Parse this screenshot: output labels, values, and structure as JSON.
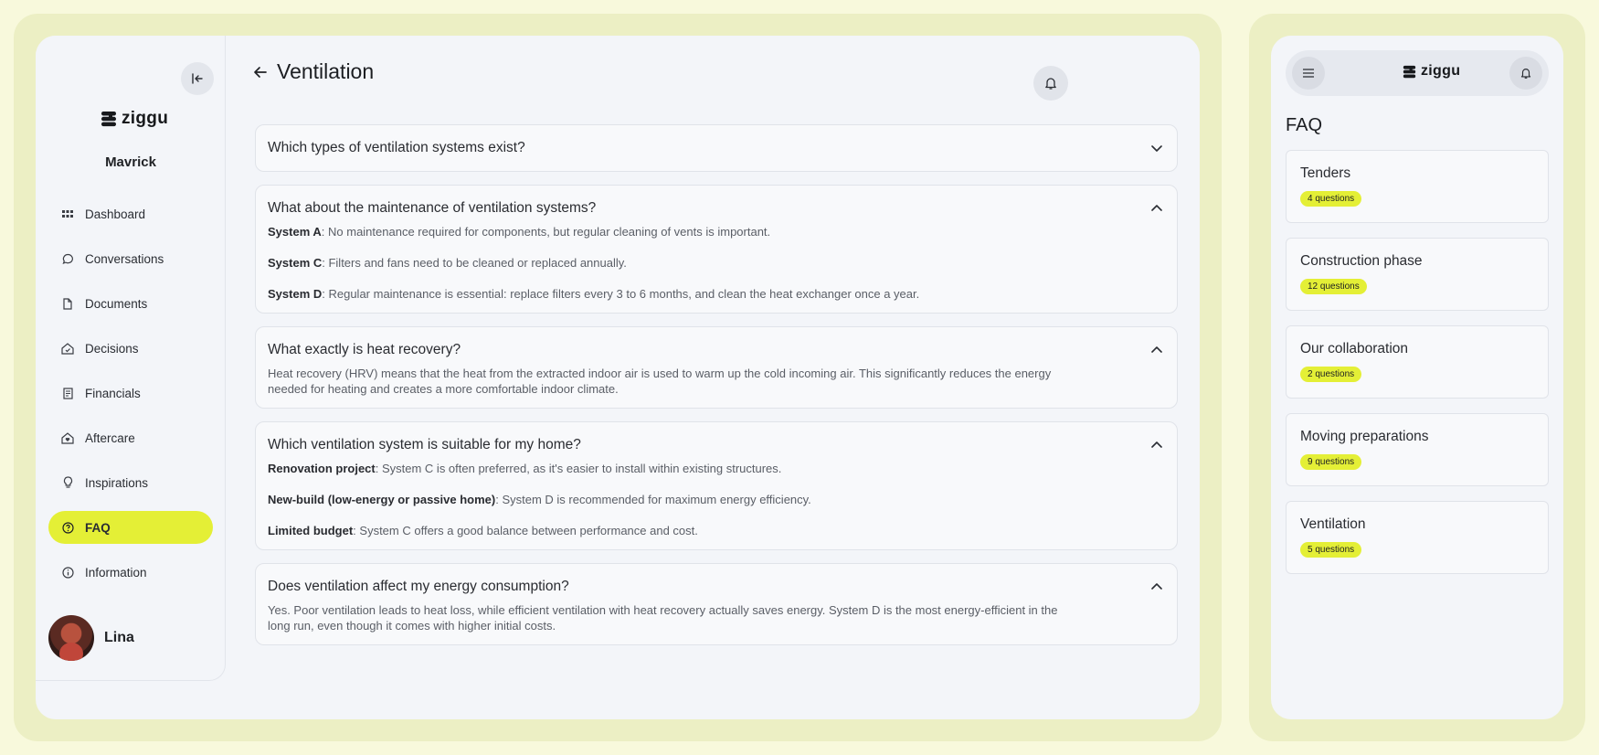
{
  "brand": {
    "name": "ziggu"
  },
  "sidebar": {
    "user_title": "Mavrick",
    "items": [
      {
        "label": "Dashboard",
        "icon": "grid-icon"
      },
      {
        "label": "Conversations",
        "icon": "chat-icon"
      },
      {
        "label": "Documents",
        "icon": "document-icon"
      },
      {
        "label": "Decisions",
        "icon": "house-check-icon"
      },
      {
        "label": "Financials",
        "icon": "receipt-icon"
      },
      {
        "label": "Aftercare",
        "icon": "house-heart-icon"
      },
      {
        "label": "Inspirations",
        "icon": "lightbulb-icon"
      },
      {
        "label": "FAQ",
        "icon": "question-icon",
        "active": true
      },
      {
        "label": "Information",
        "icon": "info-icon"
      }
    ],
    "profile_name": "Lina"
  },
  "main": {
    "title": "Ventilation",
    "faqs": [
      {
        "question": "Which types of ventilation systems exist?",
        "expanded": false
      },
      {
        "question": "What about the maintenance of ventilation systems?",
        "expanded": true,
        "answer_items": [
          {
            "label": "System A",
            "text": ": No maintenance required for components, but regular cleaning of vents is important."
          },
          {
            "label": "System C",
            "text": ": Filters and fans need to be cleaned or replaced annually."
          },
          {
            "label": "System D",
            "text": ": Regular maintenance is essential: replace filters every 3 to 6 months, and clean the heat exchanger once a year."
          }
        ]
      },
      {
        "question": "What exactly is heat recovery?",
        "expanded": true,
        "answer": "Heat recovery (HRV) means that the heat from the extracted indoor air is used to warm up the cold incoming air. This significantly reduces the energy needed for heating and creates a more comfortable indoor climate."
      },
      {
        "question": "Which ventilation system is suitable for my home?",
        "expanded": true,
        "answer_items": [
          {
            "label": "Renovation project",
            "text": ": System C is often preferred, as it's easier to install within existing structures."
          },
          {
            "label": "New-build (low-energy or passive home)",
            "text": ": System D is recommended for maximum energy efficiency."
          },
          {
            "label": "Limited budget",
            "text": ": System C offers a good balance between performance and cost."
          }
        ]
      },
      {
        "question": "Does ventilation affect my energy consumption?",
        "expanded": true,
        "answer": "Yes. Poor ventilation leads to heat loss, while efficient ventilation with heat recovery actually saves energy. System D is the most energy-efficient in the long run, even though it comes with higher initial costs."
      }
    ]
  },
  "mobile": {
    "title": "FAQ",
    "categories": [
      {
        "name": "Tenders",
        "count": "4 questions"
      },
      {
        "name": "Construction phase",
        "count": "12 questions"
      },
      {
        "name": "Our collaboration",
        "count": "2 questions"
      },
      {
        "name": "Moving preparations",
        "count": "9 questions"
      },
      {
        "name": "Ventilation",
        "count": "5 questions"
      }
    ]
  },
  "colors": {
    "accent": "#e4ef36",
    "frame": "#ecefc4",
    "background": "#f8f9dc"
  }
}
